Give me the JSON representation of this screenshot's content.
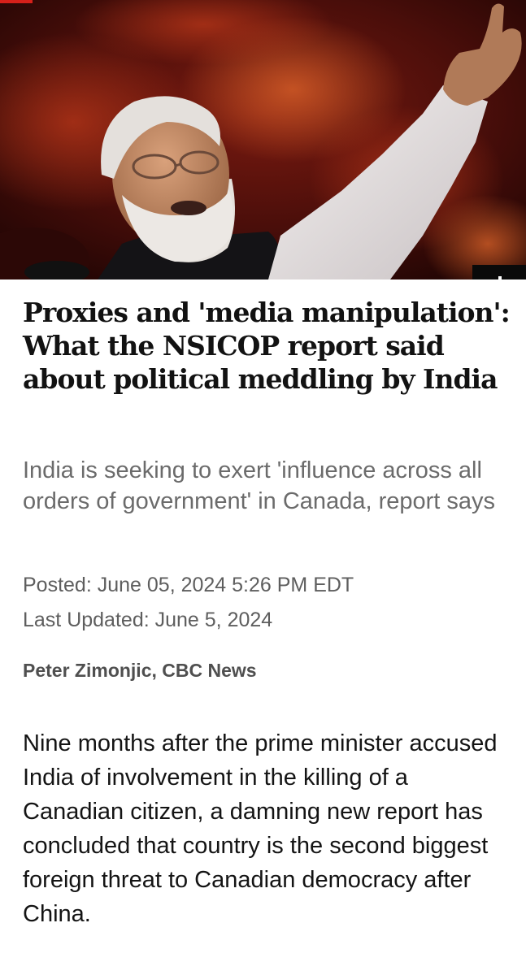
{
  "article": {
    "headline": "Proxies and 'media manipulation': What the NSICOP report said about political meddling by India",
    "deck": "India is seeking to exert 'influence across all orders of government' in Canada, report says",
    "posted": "Posted: June 05, 2024 5:26 PM EDT",
    "updated": "Last Updated: June 5, 2024",
    "byline": "Peter Zimonjic, CBC News",
    "body": "Nine months after the prime minister accused India of involvement in the killing of a Canadian citizen, a damning new report has concluded that country is the second biggest foreign threat to Canadian democracy after China."
  },
  "colors": {
    "accent": "#d6201a",
    "headline": "#121212",
    "deck": "#6b6b6b",
    "meta": "#5e5e5e",
    "body": "#141414"
  }
}
